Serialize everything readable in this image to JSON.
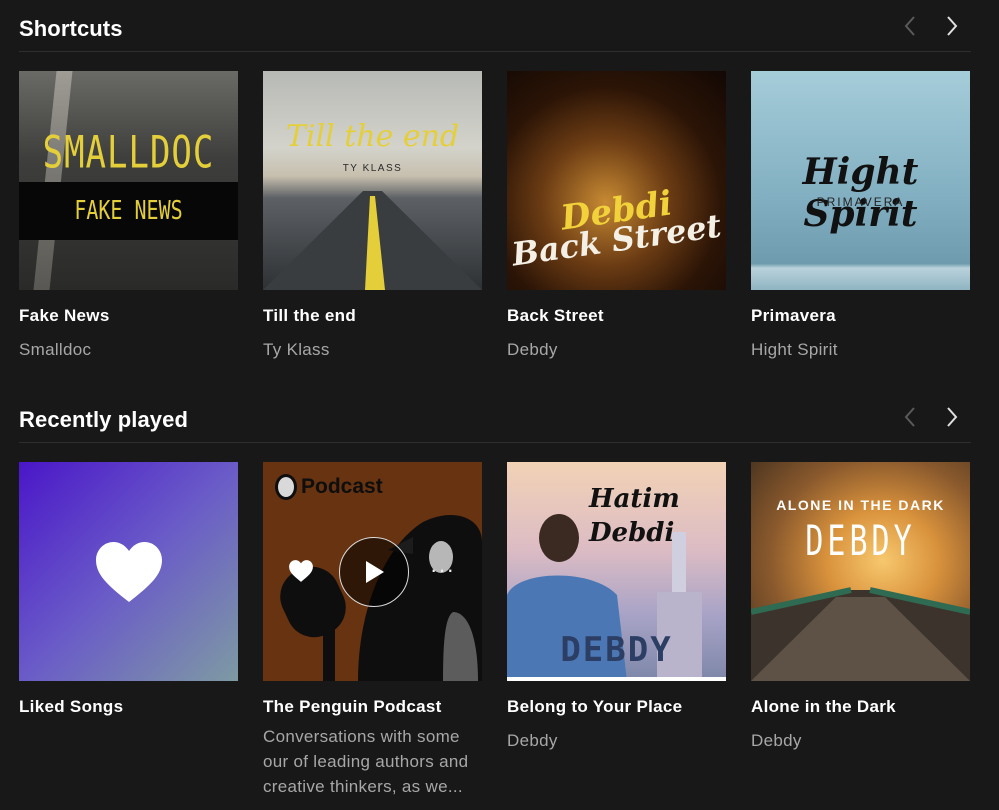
{
  "shortcuts": {
    "title": "Shortcuts",
    "cards": [
      {
        "title": "Fake News",
        "subtitle": "Smalldoc",
        "cover_text_1": "SMALLDOC",
        "cover_text_2": "FAKE NEWS"
      },
      {
        "title": "Till the end",
        "subtitle": "Ty Klass",
        "cover_text_1": "Till the end",
        "cover_text_2": "TY KLASS"
      },
      {
        "title": "Back Street",
        "subtitle": "Debdy",
        "cover_text_1": "Debdi",
        "cover_text_2": "Back Street"
      },
      {
        "title": "Primavera",
        "subtitle": "Hight Spirit",
        "cover_text_1": "Hight Spirit",
        "cover_text_2": "PRIMAVERA"
      }
    ]
  },
  "recently_played": {
    "title": "Recently played",
    "cards": [
      {
        "title": "Liked Songs",
        "subtitle": ""
      },
      {
        "title": "The Penguin Podcast",
        "subtitle": "Conversations with some our of leading authors and creative thinkers, as we...",
        "cover_text_1": "Podcast"
      },
      {
        "title": "Belong to Your Place",
        "subtitle": "Debdy",
        "cover_text_1": "Hatim Debdi",
        "cover_text_2": "DEBDY",
        "progress": 1.0
      },
      {
        "title": "Alone in the Dark",
        "subtitle": "Debdy",
        "cover_text_1": "ALONE IN THE DARK",
        "cover_text_2": "DEBDY"
      }
    ]
  },
  "icons": {
    "prev": "chevron-left-icon",
    "next": "chevron-right-icon",
    "heart": "heart-icon",
    "play": "play-icon",
    "more": "more-dots-icon"
  },
  "colors": {
    "background": "#181818",
    "subtitle": "#a7a7a7",
    "divider": "#2e2e2e"
  }
}
